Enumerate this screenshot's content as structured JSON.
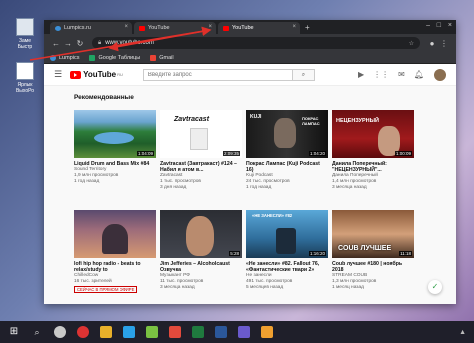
{
  "desktop": {
    "icons": [
      {
        "label": "Заме\nБыстр"
      },
      {
        "label": "Ярлык\nВыхоРо"
      }
    ]
  },
  "browser": {
    "tabs": [
      {
        "title": "Lumpics.ru"
      },
      {
        "title": "YouTube"
      },
      {
        "title": "YouTube"
      }
    ],
    "new_tab": "+",
    "url": "www.youtube.com",
    "bookmarks": [
      {
        "label": "Lumpics"
      },
      {
        "label": "Google Таблицы"
      },
      {
        "label": "Gmail"
      }
    ]
  },
  "youtube": {
    "logo_text": "YouTube",
    "logo_sup": "RU",
    "search_placeholder": "Введите запрос",
    "section_title": "Рекомендованные",
    "videos_row1": [
      {
        "title": "Liquid Drum and Bass Mix #84",
        "channel": "Sound Territory",
        "views": "1,9 млн просмотров",
        "age": "1 год назад",
        "duration": "1:04:09"
      },
      {
        "title": "Zavtracast (Завтракаст) #124 – Набил я атом в...",
        "channel": "Zavtracast",
        "views": "1 тыс. просмотров",
        "age": "3 дня назад",
        "duration": "2:09:35"
      },
      {
        "title": "Покрас Лампас (Kuji Podcast 16)",
        "channel": "Kuji Podcast",
        "views": "24 тыс. просмотров",
        "age": "1 год назад",
        "duration": "1:04:20"
      },
      {
        "title": "Данила Поперечный: \"НЕЦЕНЗУРНЫЙ\"...",
        "channel": "Данила Поперечный",
        "views": "1,4 млн просмотров",
        "age": "3 месяца назад",
        "duration": "1:00:09"
      }
    ],
    "videos_row2": [
      {
        "title": "lofi hip hop radio - beats to relax/study to",
        "channel": "ChilledCow",
        "views": "16 тыс. зрителей",
        "age": "",
        "live_badge": "СЕЙЧАС В ПРЯМОМ ЭФИРЕ",
        "duration": ""
      },
      {
        "title": "Jim Jefferies – Alcoholcaust Озвучка",
        "channel": "Музыкант РФ",
        "views": "11 тыс. просмотров",
        "age": "3 месяца назад",
        "duration": "5:28"
      },
      {
        "title": "«Не занесли» #82. Fallout 76, «Фантастические твари 2»",
        "channel": "Не занесли",
        "views": "491 тыс. просмотров",
        "age": "5 месяцев назад",
        "duration": "1:16:20"
      },
      {
        "title": "Coub лучшее #180 | ноябрь 2018",
        "channel": "STREAM COUB",
        "views": "1,3 млн просмотров",
        "age": "1 месяц назад",
        "duration": "11:18"
      }
    ],
    "thumb_text": {
      "zavtracast": "Zavtracast",
      "kuji_left": "KUJI",
      "kuji_right": "ПОКРАС ЛАМПАС",
      "nepr": "НЕЦЕНЗУРНЫЙ",
      "fallout": "«НЕ ЗАНЕСЛИ» #82",
      "coub": "COUB ЛУЧШЕЕ"
    }
  },
  "colors": {
    "yt_red": "#ff0000",
    "chrome_dark": "#35363a",
    "annotation_red": "#e0302a"
  }
}
